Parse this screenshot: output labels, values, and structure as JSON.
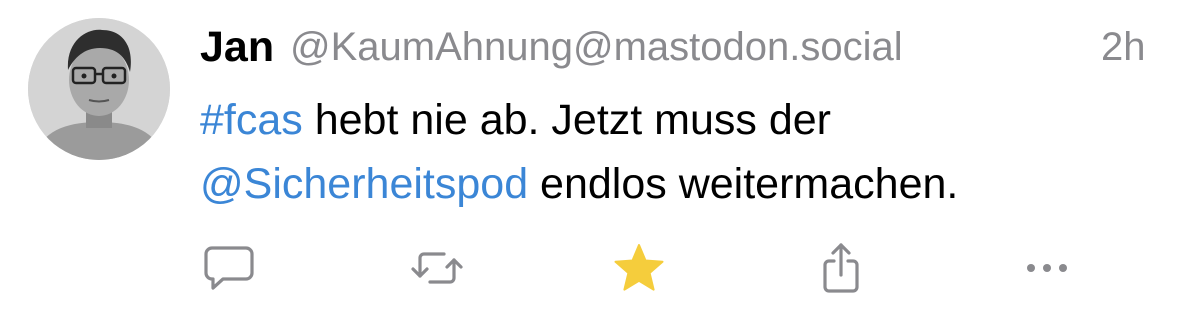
{
  "post": {
    "author": {
      "display_name": "Jan",
      "handle": "@KaumAhnung@mastodon.social"
    },
    "timestamp": "2h",
    "content": {
      "line1": {
        "hashtag": "#fcas",
        "text": " hebt nie ab. Jetzt muss der"
      },
      "line2": {
        "mention": "@Sicherheitspod",
        "text": " endlos weitermachen."
      }
    },
    "colors": {
      "link": "#3b86d6",
      "meta": "#8a8a8e",
      "star": "#f5cd3c",
      "icon": "#8a8a8e"
    },
    "actions": [
      {
        "name": "reply",
        "icon": "speech-bubble-icon"
      },
      {
        "name": "boost",
        "icon": "repeat-arrows-icon"
      },
      {
        "name": "favourite",
        "icon": "star-icon",
        "active": true
      },
      {
        "name": "share",
        "icon": "share-icon"
      },
      {
        "name": "more",
        "icon": "ellipsis-icon"
      }
    ]
  }
}
